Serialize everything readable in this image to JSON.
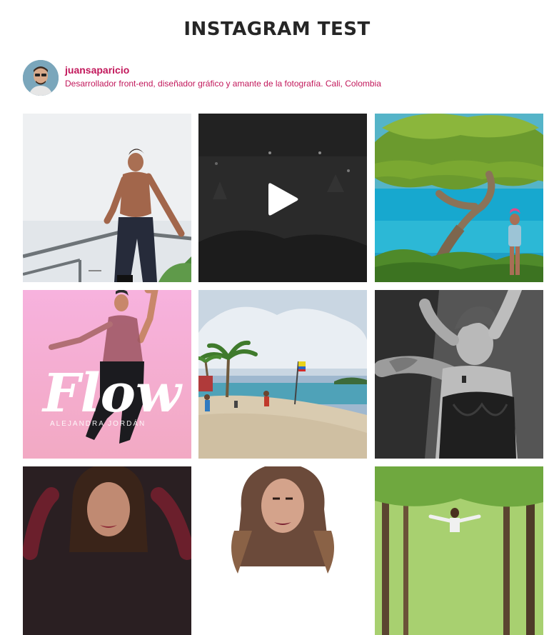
{
  "page": {
    "title": "INSTAGRAM TEST"
  },
  "profile": {
    "username": "juansaparicio",
    "bio": "Desarrollador front-end, diseñador gráfico y amante de la fotografía. Cali, Colombia"
  },
  "posts": [
    {
      "subject": "shirtless man sitting on metal railing",
      "type": "photo"
    },
    {
      "subject": "dark concert video",
      "type": "video",
      "icon": "play-icon"
    },
    {
      "subject": "tree by turquoise sea",
      "type": "photo"
    },
    {
      "subject": "dancer with Flow title",
      "type": "photo",
      "overlay_title": "Flow",
      "overlay_credit": "ALEJANDRA JORDÁN"
    },
    {
      "subject": "beach with palm trees",
      "type": "photo"
    },
    {
      "subject": "black and white portrait",
      "type": "photo"
    },
    {
      "subject": "woman portrait dark background",
      "type": "photo"
    },
    {
      "subject": "woman portrait white background",
      "type": "photo"
    },
    {
      "subject": "woman in forest",
      "type": "photo"
    }
  ],
  "colors": {
    "accent": "#c2185b",
    "title": "#262626",
    "flow_yellow": "#e8f02a"
  }
}
